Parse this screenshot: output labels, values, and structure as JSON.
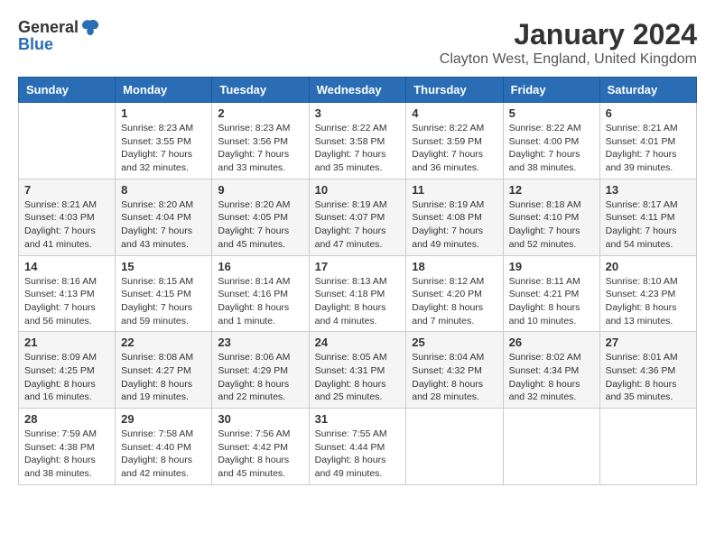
{
  "logo": {
    "general": "General",
    "blue": "Blue"
  },
  "title": "January 2024",
  "subtitle": "Clayton West, England, United Kingdom",
  "weekdays": [
    "Sunday",
    "Monday",
    "Tuesday",
    "Wednesday",
    "Thursday",
    "Friday",
    "Saturday"
  ],
  "weeks": [
    [
      {
        "day": "",
        "content": ""
      },
      {
        "day": "1",
        "content": "Sunrise: 8:23 AM\nSunset: 3:55 PM\nDaylight: 7 hours\nand 32 minutes."
      },
      {
        "day": "2",
        "content": "Sunrise: 8:23 AM\nSunset: 3:56 PM\nDaylight: 7 hours\nand 33 minutes."
      },
      {
        "day": "3",
        "content": "Sunrise: 8:22 AM\nSunset: 3:58 PM\nDaylight: 7 hours\nand 35 minutes."
      },
      {
        "day": "4",
        "content": "Sunrise: 8:22 AM\nSunset: 3:59 PM\nDaylight: 7 hours\nand 36 minutes."
      },
      {
        "day": "5",
        "content": "Sunrise: 8:22 AM\nSunset: 4:00 PM\nDaylight: 7 hours\nand 38 minutes."
      },
      {
        "day": "6",
        "content": "Sunrise: 8:21 AM\nSunset: 4:01 PM\nDaylight: 7 hours\nand 39 minutes."
      }
    ],
    [
      {
        "day": "7",
        "content": "Sunrise: 8:21 AM\nSunset: 4:03 PM\nDaylight: 7 hours\nand 41 minutes."
      },
      {
        "day": "8",
        "content": "Sunrise: 8:20 AM\nSunset: 4:04 PM\nDaylight: 7 hours\nand 43 minutes."
      },
      {
        "day": "9",
        "content": "Sunrise: 8:20 AM\nSunset: 4:05 PM\nDaylight: 7 hours\nand 45 minutes."
      },
      {
        "day": "10",
        "content": "Sunrise: 8:19 AM\nSunset: 4:07 PM\nDaylight: 7 hours\nand 47 minutes."
      },
      {
        "day": "11",
        "content": "Sunrise: 8:19 AM\nSunset: 4:08 PM\nDaylight: 7 hours\nand 49 minutes."
      },
      {
        "day": "12",
        "content": "Sunrise: 8:18 AM\nSunset: 4:10 PM\nDaylight: 7 hours\nand 52 minutes."
      },
      {
        "day": "13",
        "content": "Sunrise: 8:17 AM\nSunset: 4:11 PM\nDaylight: 7 hours\nand 54 minutes."
      }
    ],
    [
      {
        "day": "14",
        "content": "Sunrise: 8:16 AM\nSunset: 4:13 PM\nDaylight: 7 hours\nand 56 minutes."
      },
      {
        "day": "15",
        "content": "Sunrise: 8:15 AM\nSunset: 4:15 PM\nDaylight: 7 hours\nand 59 minutes."
      },
      {
        "day": "16",
        "content": "Sunrise: 8:14 AM\nSunset: 4:16 PM\nDaylight: 8 hours\nand 1 minute."
      },
      {
        "day": "17",
        "content": "Sunrise: 8:13 AM\nSunset: 4:18 PM\nDaylight: 8 hours\nand 4 minutes."
      },
      {
        "day": "18",
        "content": "Sunrise: 8:12 AM\nSunset: 4:20 PM\nDaylight: 8 hours\nand 7 minutes."
      },
      {
        "day": "19",
        "content": "Sunrise: 8:11 AM\nSunset: 4:21 PM\nDaylight: 8 hours\nand 10 minutes."
      },
      {
        "day": "20",
        "content": "Sunrise: 8:10 AM\nSunset: 4:23 PM\nDaylight: 8 hours\nand 13 minutes."
      }
    ],
    [
      {
        "day": "21",
        "content": "Sunrise: 8:09 AM\nSunset: 4:25 PM\nDaylight: 8 hours\nand 16 minutes."
      },
      {
        "day": "22",
        "content": "Sunrise: 8:08 AM\nSunset: 4:27 PM\nDaylight: 8 hours\nand 19 minutes."
      },
      {
        "day": "23",
        "content": "Sunrise: 8:06 AM\nSunset: 4:29 PM\nDaylight: 8 hours\nand 22 minutes."
      },
      {
        "day": "24",
        "content": "Sunrise: 8:05 AM\nSunset: 4:31 PM\nDaylight: 8 hours\nand 25 minutes."
      },
      {
        "day": "25",
        "content": "Sunrise: 8:04 AM\nSunset: 4:32 PM\nDaylight: 8 hours\nand 28 minutes."
      },
      {
        "day": "26",
        "content": "Sunrise: 8:02 AM\nSunset: 4:34 PM\nDaylight: 8 hours\nand 32 minutes."
      },
      {
        "day": "27",
        "content": "Sunrise: 8:01 AM\nSunset: 4:36 PM\nDaylight: 8 hours\nand 35 minutes."
      }
    ],
    [
      {
        "day": "28",
        "content": "Sunrise: 7:59 AM\nSunset: 4:38 PM\nDaylight: 8 hours\nand 38 minutes."
      },
      {
        "day": "29",
        "content": "Sunrise: 7:58 AM\nSunset: 4:40 PM\nDaylight: 8 hours\nand 42 minutes."
      },
      {
        "day": "30",
        "content": "Sunrise: 7:56 AM\nSunset: 4:42 PM\nDaylight: 8 hours\nand 45 minutes."
      },
      {
        "day": "31",
        "content": "Sunrise: 7:55 AM\nSunset: 4:44 PM\nDaylight: 8 hours\nand 49 minutes."
      },
      {
        "day": "",
        "content": ""
      },
      {
        "day": "",
        "content": ""
      },
      {
        "day": "",
        "content": ""
      }
    ]
  ]
}
